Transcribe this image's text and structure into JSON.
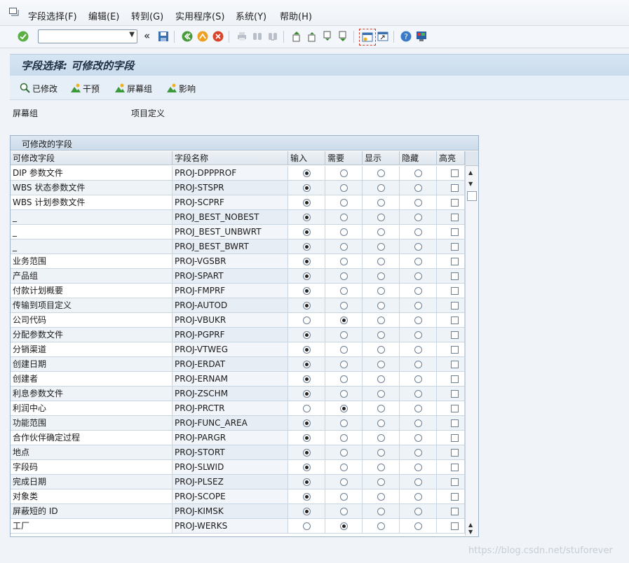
{
  "menu": {
    "items": [
      "字段选择(F)",
      "编辑(E)",
      "转到(G)",
      "实用程序(S)",
      "系统(Y)",
      "帮助(H)"
    ]
  },
  "toolbar": {
    "command_value": "",
    "back_symbol": "«",
    "icons": [
      "enter-icon",
      "save-icon",
      "back-icon",
      "exit-icon",
      "cancel-icon",
      "print-icon",
      "find-icon",
      "find-next-icon",
      "first-page-icon",
      "prev-page-icon",
      "next-page-icon",
      "last-page-icon",
      "create-session-icon",
      "shortcut-icon",
      "help-icon",
      "layout-icon"
    ]
  },
  "title": "字段选择: 可修改的字段",
  "app_toolbar": {
    "buttons": [
      "已修改",
      "干预",
      "屏幕组",
      "影响"
    ]
  },
  "info": {
    "label": "屏幕组",
    "value": "项目定义"
  },
  "group": {
    "title": "可修改的字段",
    "columns": [
      "可修改字段",
      "字段名称",
      "输入",
      "需要",
      "显示",
      "隐藏",
      "高亮"
    ],
    "rows": [
      {
        "desc": "DIP 参数文件",
        "name": "PROJ-DPPPROF",
        "sel": "input"
      },
      {
        "desc": "WBS 状态参数文件",
        "name": "PROJ-STSPR",
        "sel": "input"
      },
      {
        "desc": "WBS 计划参数文件",
        "name": "PROJ-SCPRF",
        "sel": "input"
      },
      {
        "desc": "_",
        "name": "PROJ_BEST_NOBEST",
        "sel": "input"
      },
      {
        "desc": "_",
        "name": "PROJ_BEST_UNBWRT",
        "sel": "input"
      },
      {
        "desc": "_",
        "name": "PROJ_BEST_BWRT",
        "sel": "input"
      },
      {
        "desc": "业务范围",
        "name": "PROJ-VGSBR",
        "sel": "input"
      },
      {
        "desc": "产品组",
        "name": "PROJ-SPART",
        "sel": "input"
      },
      {
        "desc": "付款计划概要",
        "name": "PROJ-FMPRF",
        "sel": "input"
      },
      {
        "desc": "传输到项目定义",
        "name": "PROJ-AUTOD",
        "sel": "input"
      },
      {
        "desc": "公司代码",
        "name": "PROJ-VBUKR",
        "sel": "required"
      },
      {
        "desc": "分配参数文件",
        "name": "PROJ-PGPRF",
        "sel": "input"
      },
      {
        "desc": "分销渠道",
        "name": "PROJ-VTWEG",
        "sel": "input"
      },
      {
        "desc": "创建日期",
        "name": "PROJ-ERDAT",
        "sel": "input"
      },
      {
        "desc": "创建者",
        "name": "PROJ-ERNAM",
        "sel": "input"
      },
      {
        "desc": "利息参数文件",
        "name": "PROJ-ZSCHM",
        "sel": "input"
      },
      {
        "desc": "利润中心",
        "name": "PROJ-PRCTR",
        "sel": "required"
      },
      {
        "desc": "功能范围",
        "name": "PROJ-FUNC_AREA",
        "sel": "input"
      },
      {
        "desc": "合作伙伴确定过程",
        "name": "PROJ-PARGR",
        "sel": "input"
      },
      {
        "desc": "地点",
        "name": "PROJ-STORT",
        "sel": "input"
      },
      {
        "desc": "字段码",
        "name": "PROJ-SLWID",
        "sel": "input"
      },
      {
        "desc": "完成日期",
        "name": "PROJ-PLSEZ",
        "sel": "input"
      },
      {
        "desc": "对象类",
        "name": "PROJ-SCOPE",
        "sel": "input"
      },
      {
        "desc": "屏蔽短的 ID",
        "name": "PROJ-KIMSK",
        "sel": "input"
      },
      {
        "desc": "工厂",
        "name": "PROJ-WERKS",
        "sel": "required"
      }
    ]
  },
  "watermark": "https://blog.csdn.net/stuforever"
}
